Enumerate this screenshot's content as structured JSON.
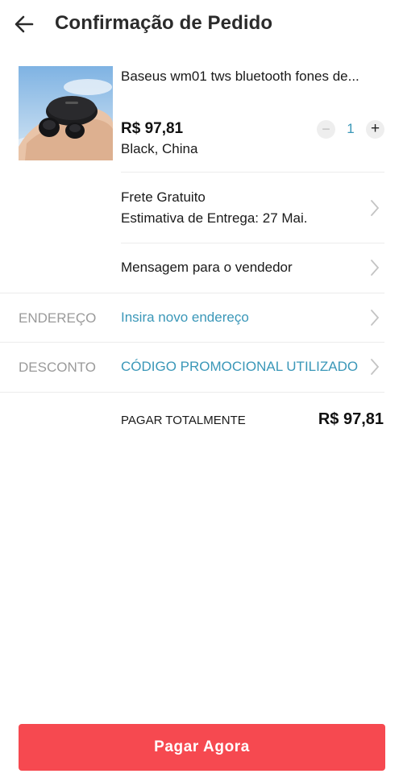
{
  "header": {
    "title": "Confirmação de Pedido",
    "back_icon": "arrow-left-icon"
  },
  "product": {
    "name": "Baseus wm01 tws bluetooth fones de...",
    "price": "R$ 97,81",
    "variant": "Black,  China",
    "image": "earbuds-product-photo",
    "quantity": {
      "minus_symbol": "−",
      "value": "1",
      "plus_symbol": "+"
    }
  },
  "shipping": {
    "line1": "Frete Gratuito",
    "line2": "Estimativa de Entrega: 27 Mai."
  },
  "message": {
    "label": "Mensagem para o vendedor"
  },
  "address": {
    "label": "ENDEREÇO",
    "value": "Insira novo endereço"
  },
  "discount": {
    "label": "DESCONTO",
    "value": "CÓDIGO PROMOCIONAL UTILIZADO"
  },
  "total": {
    "label": "PAGAR TOTALMENTE",
    "value": "R$ 97,81"
  },
  "pay_button": {
    "label": "Pagar Agora"
  },
  "colors": {
    "accent_link": "#3a97b8",
    "pay_button": "#f64950",
    "muted_label": "#9a9a9a"
  }
}
